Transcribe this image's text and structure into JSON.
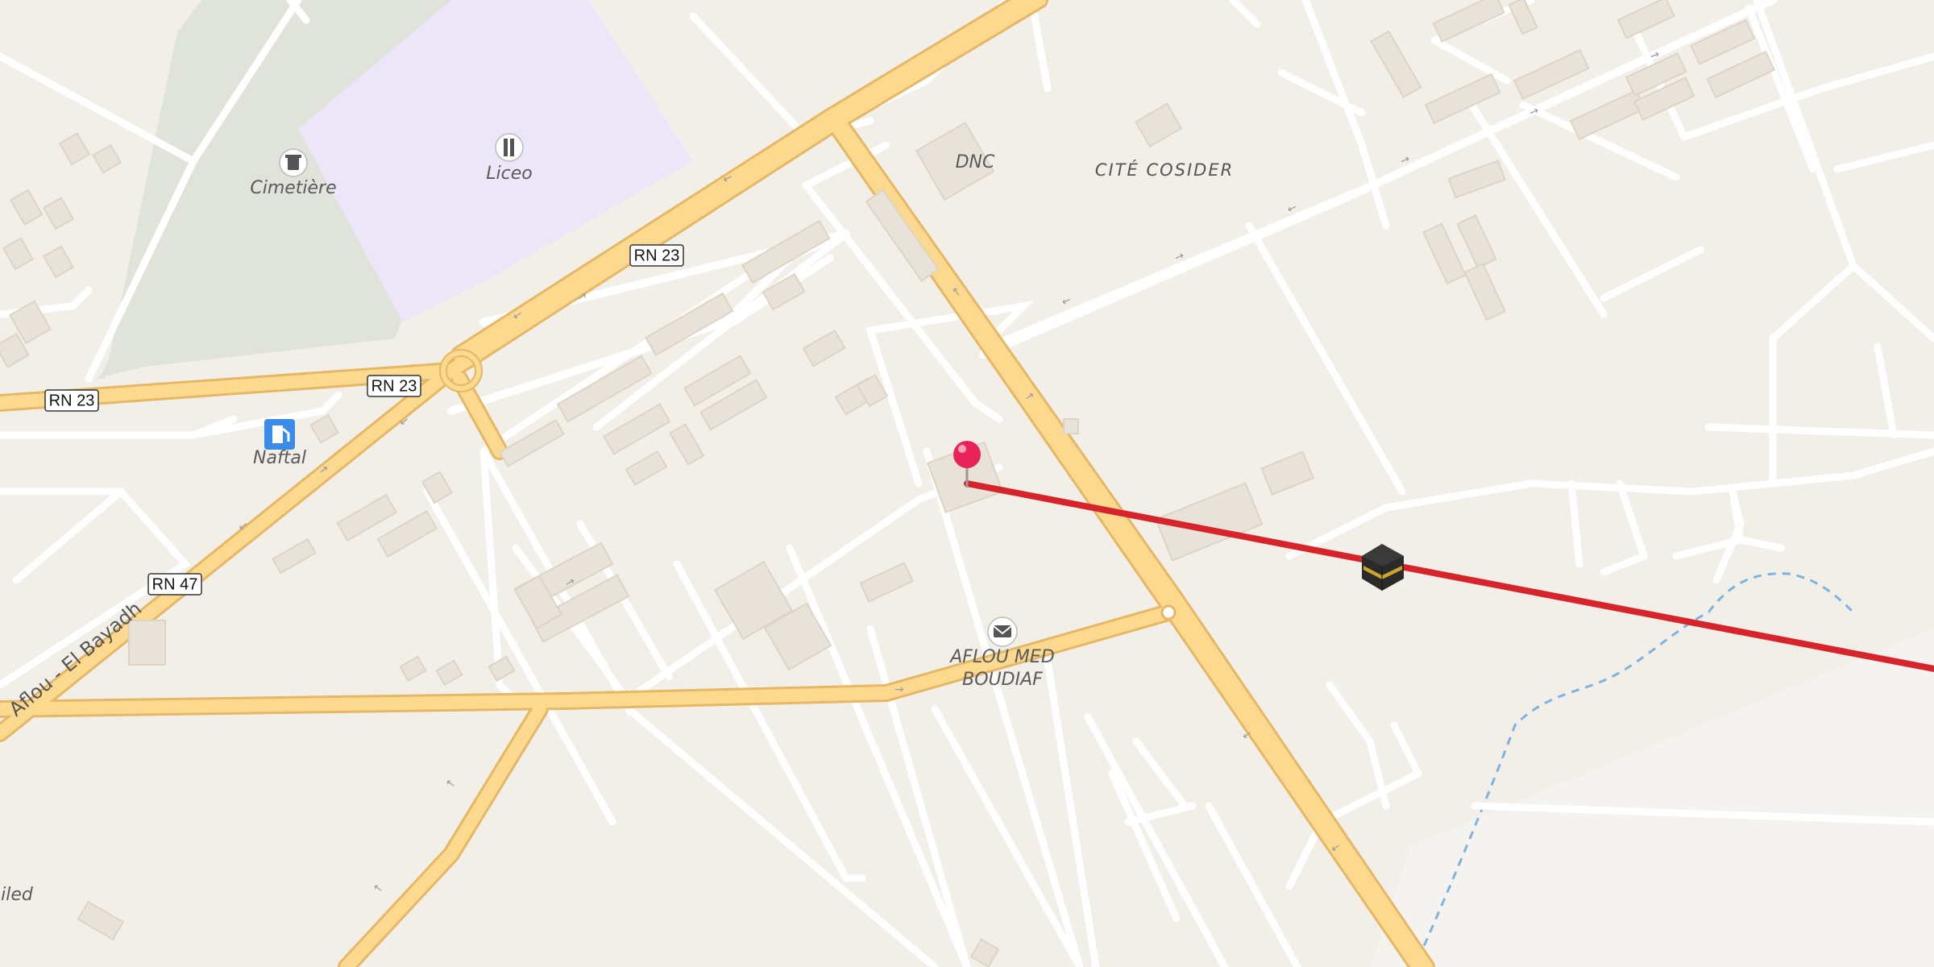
{
  "map": {
    "place_labels": {
      "cimetiere": "Cimetière",
      "liceo": "Liceo",
      "naftal": "Naftal",
      "dnc": "DNC",
      "cite_cosider": "CITÉ COSIDER",
      "post_office_line1": "AFLOU MED",
      "post_office_line2": "BOUDIAF",
      "partial_left": "uiled"
    },
    "road_shields": [
      "RN 23",
      "RN 23",
      "RN 23",
      "RN 47"
    ],
    "road_name": "Aflou - El Bayadh",
    "colors": {
      "background": "#f2efe9",
      "minor_road": "#ffffff",
      "major_road": "#fbd98e",
      "major_road_casing": "#e6b765",
      "cemetery": "#dfe3da",
      "school": "#ece6f8",
      "building": "#e9e2d8",
      "route_line": "#d6242a",
      "pin": "#e8225a",
      "water": "#7db3e0",
      "fuel_icon": "#3b8be8"
    },
    "icons": {
      "cemetery": "cemetery-icon",
      "school": "school-icon",
      "fuel": "fuel-station-icon",
      "post": "post-office-icon",
      "kaaba": "kaaba-icon",
      "pin": "location-pin-icon"
    }
  }
}
